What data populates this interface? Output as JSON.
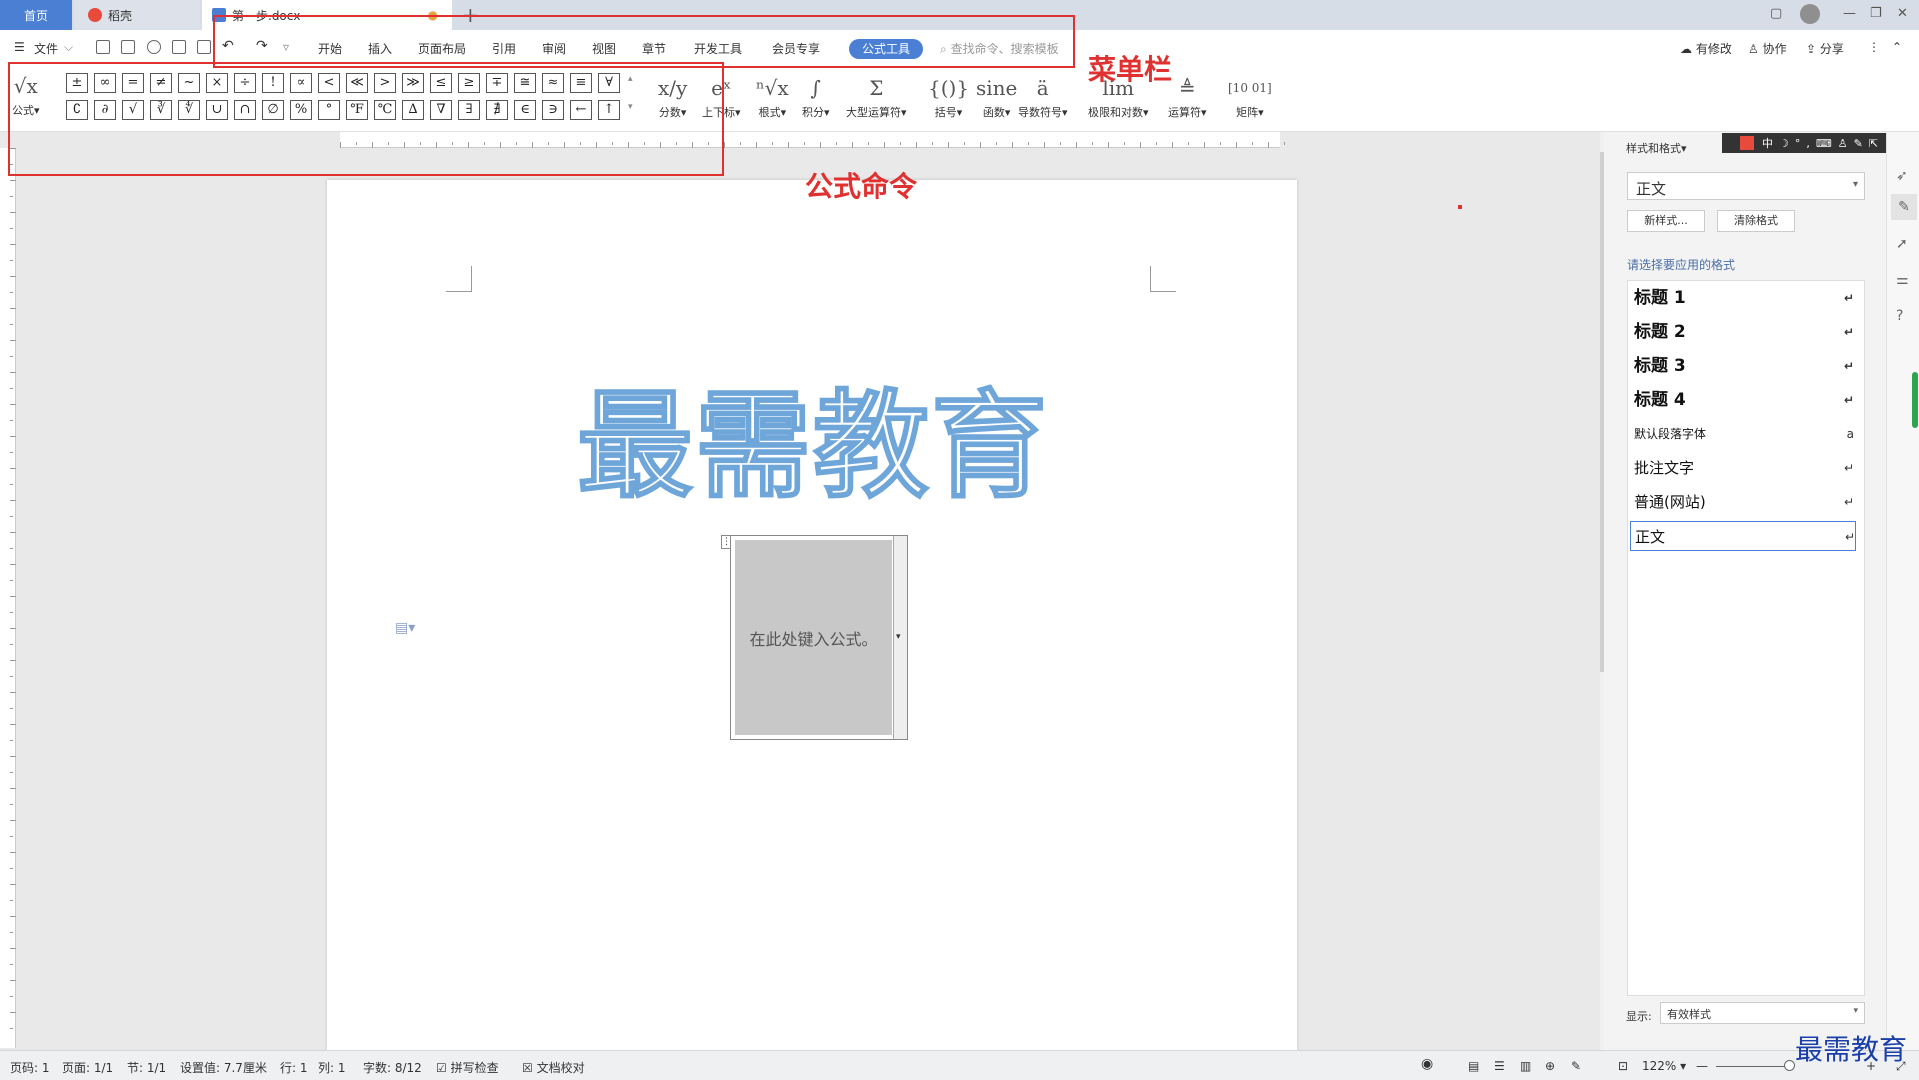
{
  "tabs": {
    "home": "首页",
    "daoke": "稻壳",
    "doc": "第一步.docx"
  },
  "menu": {
    "file": "文件",
    "items": [
      "开始",
      "插入",
      "页面布局",
      "引用",
      "审阅",
      "视图",
      "章节",
      "开发工具",
      "会员专享"
    ],
    "active": "公式工具",
    "search_placeholder": "查找命令、搜索模板",
    "right": [
      "有修改",
      "协作",
      "分享"
    ]
  },
  "ribbon": {
    "formula_label": "公式",
    "symbols_row1": [
      "±",
      "∞",
      "=",
      "≠",
      "~",
      "×",
      "÷",
      "!",
      "∝",
      "<",
      "≪",
      ">",
      "≫",
      "≤",
      "≥",
      "∓",
      "≅",
      "≈",
      "≡",
      "∀"
    ],
    "symbols_row2": [
      "∁",
      "∂",
      "√",
      "∛",
      "∜",
      "∪",
      "∩",
      "∅",
      "%",
      "°",
      "℉",
      "℃",
      "∆",
      "∇",
      "∃",
      "∄",
      "∈",
      "∋",
      "←",
      "↑"
    ],
    "groups": [
      {
        "icon": "x/y",
        "label": "分数"
      },
      {
        "icon": "eˣ",
        "label": "上下标"
      },
      {
        "icon": "ⁿ√x",
        "label": "根式"
      },
      {
        "icon": "∫",
        "label": "积分"
      },
      {
        "icon": "Σ",
        "label": "大型运算符"
      },
      {
        "icon": "{()}",
        "label": "括号"
      },
      {
        "icon": "sine",
        "label": "函数"
      },
      {
        "icon": "ä",
        "label": "导数符号"
      },
      {
        "icon": "lim",
        "label": "极限和对数"
      },
      {
        "icon": "≜",
        "label": "运算符"
      },
      {
        "icon": "[10 01]",
        "label": "矩阵"
      }
    ]
  },
  "annotations": {
    "menu_bar": "菜单栏",
    "formula_cmd": "公式命令"
  },
  "document": {
    "watermark": "最需教育",
    "equation_placeholder": "在此处键入公式。"
  },
  "style_panel": {
    "title": "样式和格式",
    "current": "正文",
    "new_style": "新样式...",
    "clear_format": "清除格式",
    "prompt": "请选择要应用的格式",
    "styles": [
      "标题 1",
      "标题 2",
      "标题 3",
      "标题 4",
      "默认段落字体",
      "批注文字",
      "普通(网站)",
      "正文"
    ],
    "show_label": "显示:",
    "show_value": "有效样式"
  },
  "status": {
    "page_code": "页码: 1",
    "page": "页面: 1/1",
    "section": "节: 1/1",
    "setting": "设置值: 7.7厘米",
    "row": "行: 1",
    "col": "列: 1",
    "words": "字数: 8/12",
    "spell": "拼写检查",
    "proof": "文档校对",
    "zoom": "122%"
  },
  "brand": "最需教育",
  "colors": {
    "accent": "#4a7fd4",
    "annotation": "#e03131",
    "watermark_stroke": "#6fa6d9"
  }
}
